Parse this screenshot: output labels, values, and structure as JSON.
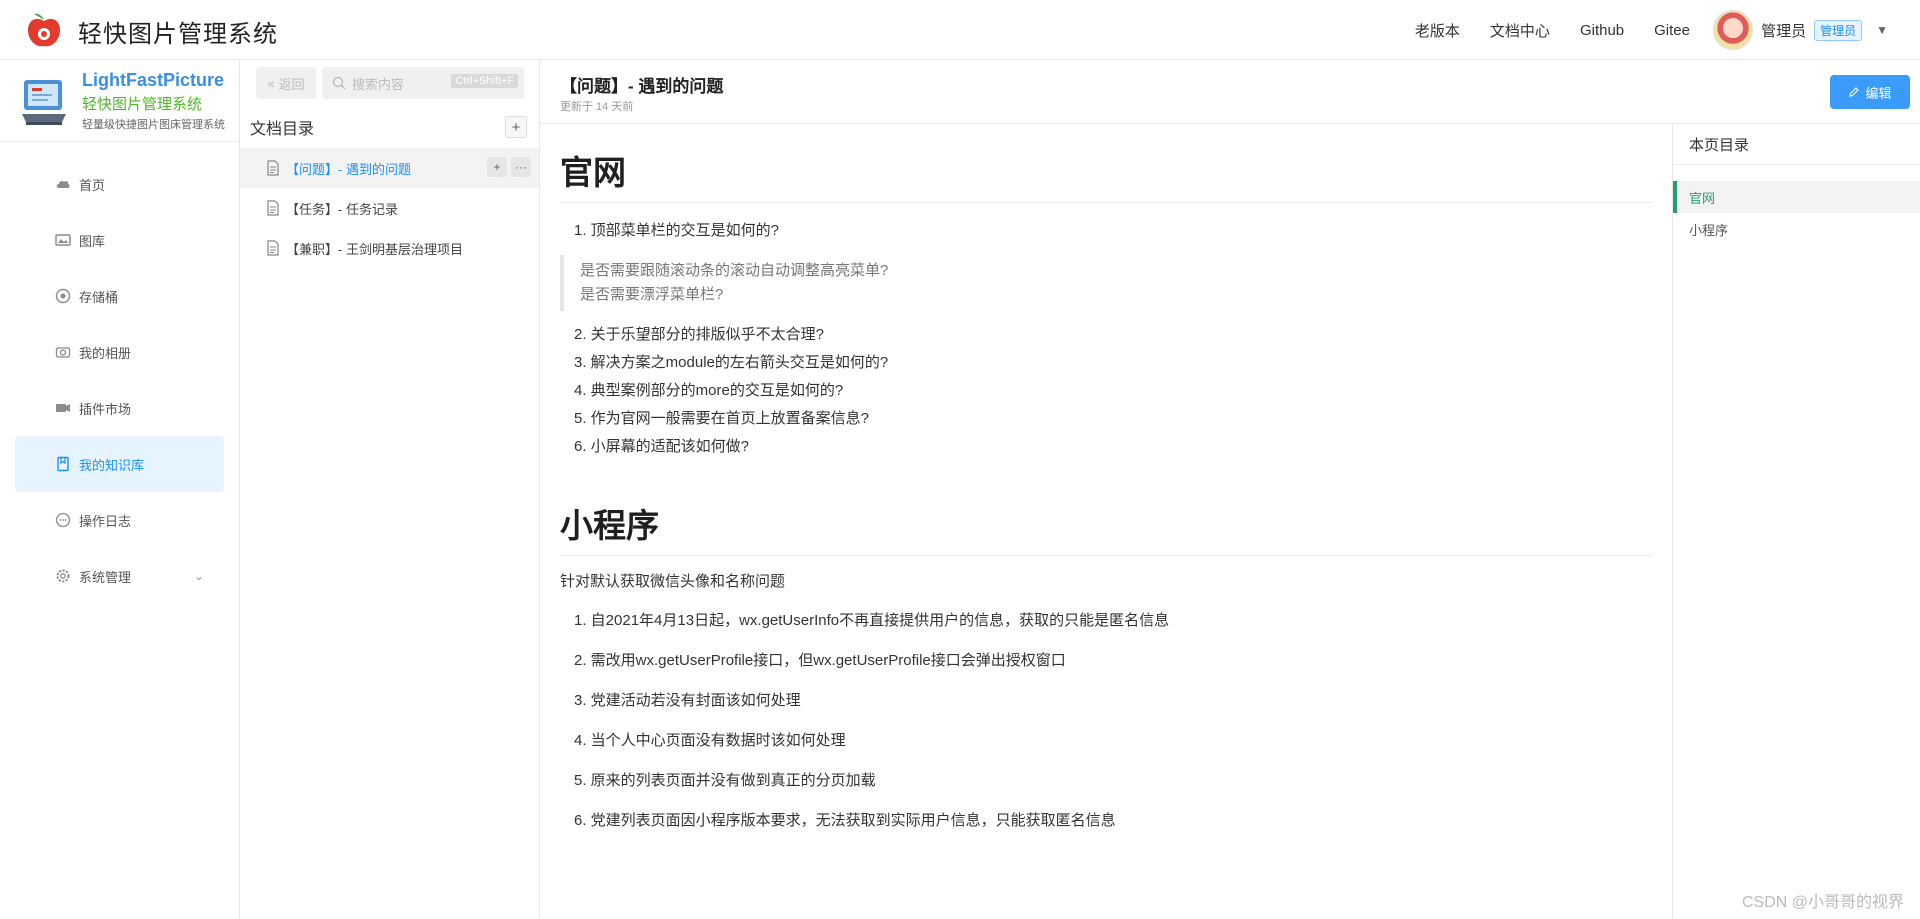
{
  "header": {
    "app_title": "轻快图片管理系统",
    "nav": [
      "老版本",
      "文档中心",
      "Github",
      "Gitee"
    ],
    "user_name": "管理员",
    "user_role": "管理员"
  },
  "brand": {
    "name": "LightFastPicture",
    "subtitle": "轻快图片管理系统",
    "tagline": "轻量级快捷图片图床管理系统"
  },
  "sidebar": {
    "items": [
      {
        "label": "首页",
        "icon": "cloud-icon"
      },
      {
        "label": "图库",
        "icon": "image-icon"
      },
      {
        "label": "存储桶",
        "icon": "bucket-icon"
      },
      {
        "label": "我的相册",
        "icon": "camera-icon"
      },
      {
        "label": "插件市场",
        "icon": "plugin-icon"
      },
      {
        "label": "我的知识库",
        "icon": "book-icon",
        "active": true
      },
      {
        "label": "操作日志",
        "icon": "chat-icon"
      },
      {
        "label": "系统管理",
        "icon": "gear-icon"
      }
    ]
  },
  "docpanel": {
    "back_label": "返回",
    "search_placeholder": "搜索内容",
    "search_shortcut": "Ctrl+Shift+F",
    "tree_title": "文档目录",
    "docs": [
      "【问题】- 遇到的问题",
      "【任务】- 任务记录",
      "【兼职】- 王剑明基层治理项目"
    ]
  },
  "doc": {
    "title": "【问题】- 遇到的问题",
    "updated": "更新于 14 天前",
    "edit_label": "编辑",
    "section1": {
      "heading": "官网",
      "q1": "1. 顶部菜单栏的交互是如何的?",
      "quote": [
        "是否需要跟随滚动条的滚动自动调整高亮菜单?",
        "是否需要漂浮菜单栏?"
      ],
      "items": [
        "2. 关于乐望部分的排版似乎不太合理?",
        "3. 解决方案之module的左右箭头交互是如何的?",
        "4. 典型案例部分的more的交互是如何的?",
        "5. 作为官网一般需要在首页上放置备案信息?",
        "6. 小屏幕的适配该如何做?"
      ]
    },
    "section2": {
      "heading": "小程序",
      "lead": "针对默认获取微信头像和名称问题",
      "items": [
        "1. 自2021年4月13日起，wx.getUserInfo不再直接提供用户的信息，获取的只能是匿名信息",
        "2. 需改用wx.getUserProfile接口，但wx.getUserProfile接口会弹出授权窗口",
        "3. 党建活动若没有封面该如何处理",
        "4. 当个人中心页面没有数据时该如何处理",
        "5. 原来的列表页面并没有做到真正的分页加载",
        "6. 党建列表页面因小程序版本要求，无法获取到实际用户信息，只能获取匿名信息"
      ]
    }
  },
  "toc": {
    "title": "本页目录",
    "items": [
      "官网",
      "小程序"
    ]
  },
  "watermark": "CSDN @小哥哥的视界"
}
